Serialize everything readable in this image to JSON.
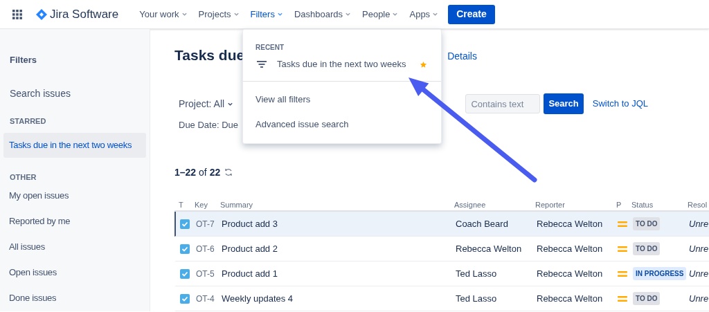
{
  "top_nav": {
    "product": "Jira Software",
    "items": [
      {
        "label": "Your work",
        "selected": false
      },
      {
        "label": "Projects",
        "selected": false
      },
      {
        "label": "Filters",
        "selected": true
      },
      {
        "label": "Dashboards",
        "selected": false
      },
      {
        "label": "People",
        "selected": false
      },
      {
        "label": "Apps",
        "selected": false
      }
    ],
    "create_button": "Create"
  },
  "sidebar": {
    "title": "Filters",
    "search_link": "Search issues",
    "sections": [
      {
        "heading": "STARRED",
        "items": [
          {
            "label": "Tasks due in the next two weeks",
            "selected": true
          }
        ]
      },
      {
        "heading": "OTHER",
        "items": [
          {
            "label": "My open issues",
            "selected": false
          },
          {
            "label": "Reported by me",
            "selected": false
          },
          {
            "label": "All issues",
            "selected": false
          },
          {
            "label": "Open issues",
            "selected": false
          },
          {
            "label": "Done issues",
            "selected": false
          }
        ]
      }
    ]
  },
  "main": {
    "title": "Tasks due",
    "details_link": "Details",
    "filters": {
      "project": "Project: All",
      "due_date": "Due Date: Due",
      "search_placeholder": "Contains text",
      "search_button": "Search",
      "jql_link": "Switch to JQL"
    },
    "count": "**1–22** of **22**",
    "table": {
      "columns": [
        "T",
        "Key",
        "Summary",
        "Assignee",
        "Reporter",
        "P",
        "Status",
        "Resol"
      ],
      "rows": [
        {
          "key": "OT-7",
          "summary": "Product add 3",
          "assignee": "Coach Beard",
          "reporter": "Rebecca Welton",
          "status": {
            "label": "TO DO",
            "kind": "todo"
          },
          "resolution": "Unre",
          "selected": true
        },
        {
          "key": "OT-6",
          "summary": "Product add 2",
          "assignee": "Rebecca Welton",
          "reporter": "Rebecca Welton",
          "status": {
            "label": "TO DO",
            "kind": "todo"
          },
          "resolution": "Unre",
          "selected": false
        },
        {
          "key": "OT-5",
          "summary": "Product add 1",
          "assignee": "Ted Lasso",
          "reporter": "Rebecca Welton",
          "status": {
            "label": "IN PROGRESS",
            "kind": "inprogress"
          },
          "resolution": "Unre",
          "selected": false
        },
        {
          "key": "OT-4",
          "summary": "Weekly updates 4",
          "assignee": "Ted Lasso",
          "reporter": "Rebecca Welton",
          "status": {
            "label": "TO DO",
            "kind": "todo"
          },
          "resolution": "Unre",
          "selected": false
        }
      ]
    }
  },
  "filters_menu": {
    "section": "RECENT",
    "recent": [
      {
        "label": "Tasks due in the next two weeks",
        "starred": true
      }
    ],
    "links": [
      "View all filters",
      "Advanced issue search"
    ]
  }
}
